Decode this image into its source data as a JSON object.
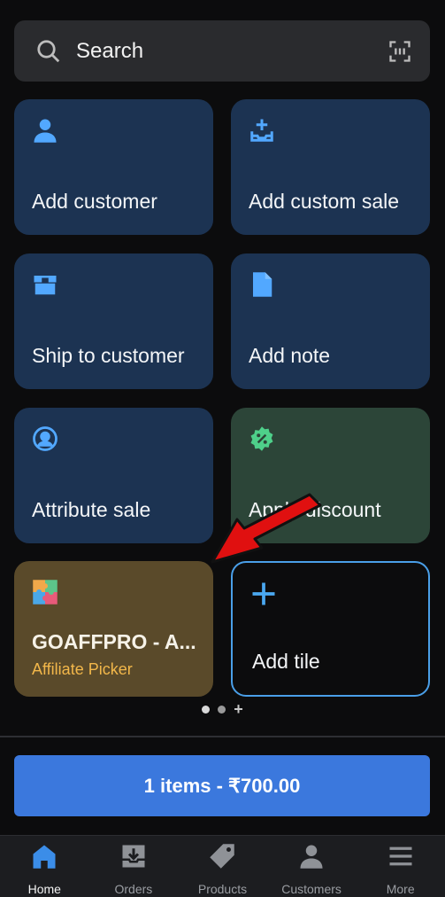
{
  "search": {
    "label": "Search"
  },
  "tiles": [
    {
      "title": "Add customer",
      "icon": "person-icon"
    },
    {
      "title": "Add custom sale",
      "icon": "tray-add-icon"
    },
    {
      "title": "Ship to customer",
      "icon": "shipping-box-icon"
    },
    {
      "title": "Add note",
      "icon": "note-icon"
    },
    {
      "title": "Attribute sale",
      "icon": "person-circle-icon"
    },
    {
      "title": "Apply discount",
      "icon": "discount-badge-icon",
      "color": "#2c4538"
    },
    {
      "title": "GOAFFPRO - A...",
      "subtitle": "Affiliate Picker",
      "icon": "puzzle-app-icon",
      "color": "#5a4a2a"
    },
    {
      "title": "Add tile",
      "icon": "plus-icon"
    }
  ],
  "checkout": {
    "label": "1 items - ₹700.00",
    "color": "#3b78dd"
  },
  "nav": [
    {
      "label": "Home",
      "icon": "home-icon",
      "active": true
    },
    {
      "label": "Orders",
      "icon": "orders-icon"
    },
    {
      "label": "Products",
      "icon": "tag-icon"
    },
    {
      "label": "Customers",
      "icon": "person-icon"
    },
    {
      "label": "More",
      "icon": "menu-icon"
    }
  ],
  "colors": {
    "accent": "#3b8de8",
    "tile": "#1c3352",
    "annotation_arrow": "#e01010"
  }
}
